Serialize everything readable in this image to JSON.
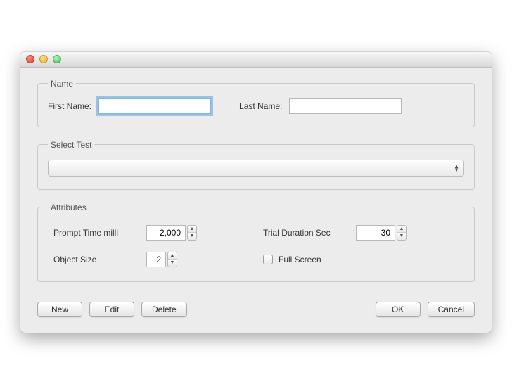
{
  "window": {
    "title": ""
  },
  "groups": {
    "name": {
      "legend": "Name",
      "first_label": "First Name:",
      "first_value": "",
      "last_label": "Last Name:",
      "last_value": ""
    },
    "select_test": {
      "legend": "Select Test",
      "selected": ""
    },
    "attributes": {
      "legend": "Attributes",
      "prompt_time_label": "Prompt Time milli",
      "prompt_time_value": "2,000",
      "trial_duration_label": "Trial Duration Sec",
      "trial_duration_value": "30",
      "object_size_label": "Object Size",
      "object_size_value": "2",
      "full_screen_label": "Full Screen",
      "full_screen_checked": false
    }
  },
  "buttons": {
    "new": "New",
    "edit": "Edit",
    "delete": "Delete",
    "ok": "OK",
    "cancel": "Cancel"
  }
}
